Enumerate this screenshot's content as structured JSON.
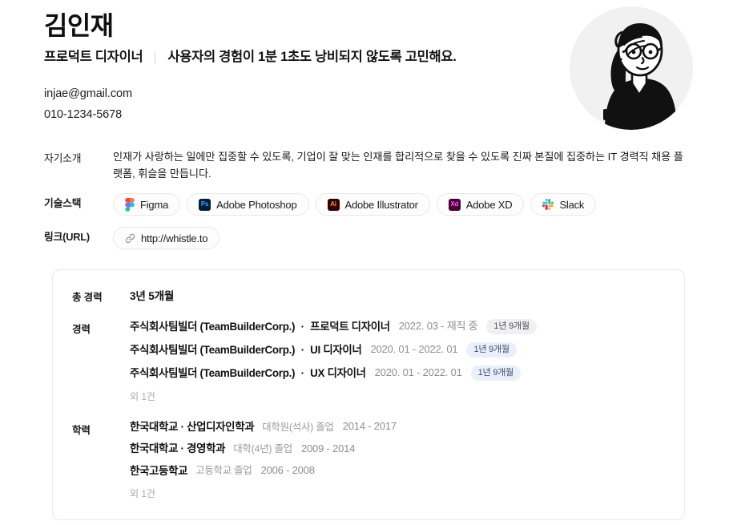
{
  "profile": {
    "name": "김인재",
    "role": "프로덕트 디자이너",
    "tagline": "사용자의 경험이 1분 1초도 낭비되지 않도록 고민해요.",
    "email": "injae@gmail.com",
    "phone": "010-1234-5678",
    "avatar_alt": "avatar-illustration"
  },
  "info": {
    "about_label": "자기소개",
    "about_text": "인재가 사랑하는 일에만 집중할 수 있도록, 기업이 잘 맞는 인재를 합리적으로 찾을 수 있도록 진짜 본질에 집중하는 IT 경력직 채용 플랫폼, 휘슬을 만듭니다.",
    "stack_label": "기술스택",
    "stack": [
      {
        "name": "Figma",
        "icon": "figma-icon"
      },
      {
        "name": "Adobe Photoshop",
        "icon": "photoshop-icon",
        "mark": "Ps",
        "bg": "#001E36",
        "fg": "#31A8FF"
      },
      {
        "name": "Adobe Illustrator",
        "icon": "illustrator-icon",
        "mark": "Ai",
        "bg": "#330000",
        "fg": "#FF9A00"
      },
      {
        "name": "Adobe XD",
        "icon": "adobe-xd-icon",
        "mark": "Xd",
        "bg": "#470137",
        "fg": "#FF61F6"
      },
      {
        "name": "Slack",
        "icon": "slack-icon"
      }
    ],
    "link_label": "링크(URL)",
    "link_url": "http://whistle.to",
    "link_icon": "link-chain-icon"
  },
  "career_card": {
    "total_label": "총 경력",
    "total_value": "3년 5개월",
    "career_label": "경력",
    "career_entries": [
      {
        "company": "주식회사팀빌더 (TeamBuilderCorp.)",
        "separator": "·",
        "position": "프로덕트 디자이너",
        "period": "2022. 03 - 재직 중",
        "duration": "1년 9개월",
        "badge_style": "gray"
      },
      {
        "company": "주식회사팀빌더 (TeamBuilderCorp.)",
        "separator": "·",
        "position": "UI 디자이너",
        "period": "2020. 01 - 2022. 01",
        "duration": "1년 9개월",
        "badge_style": "blue"
      },
      {
        "company": "주식회사팀빌더 (TeamBuilderCorp.)",
        "separator": "·",
        "position": "UX 디자이너",
        "period": "2020. 01 - 2022. 01",
        "duration": "1년 9개월",
        "badge_style": "blue"
      }
    ],
    "career_more": "외 1건",
    "edu_label": "학력",
    "edu_entries": [
      {
        "school": "한국대학교 · 산업디자인학과",
        "degree": "대학원(석사) 졸업",
        "period": "2014 - 2017"
      },
      {
        "school": "한국대학교 · 경영학과",
        "degree": "대학(4년) 졸업",
        "period": "2009 - 2014"
      },
      {
        "school": "한국고등학교",
        "degree": "고등학교 졸업",
        "period": "2006 - 2008"
      }
    ],
    "edu_more": "외 1건"
  },
  "colors": {
    "badge_gray_bg": "#f0f0f2",
    "badge_blue_bg": "#e9effb",
    "card_border": "#e9e9e9",
    "avatar_bg": "#f1f1f1",
    "muted_text": "#8e8e8e"
  }
}
